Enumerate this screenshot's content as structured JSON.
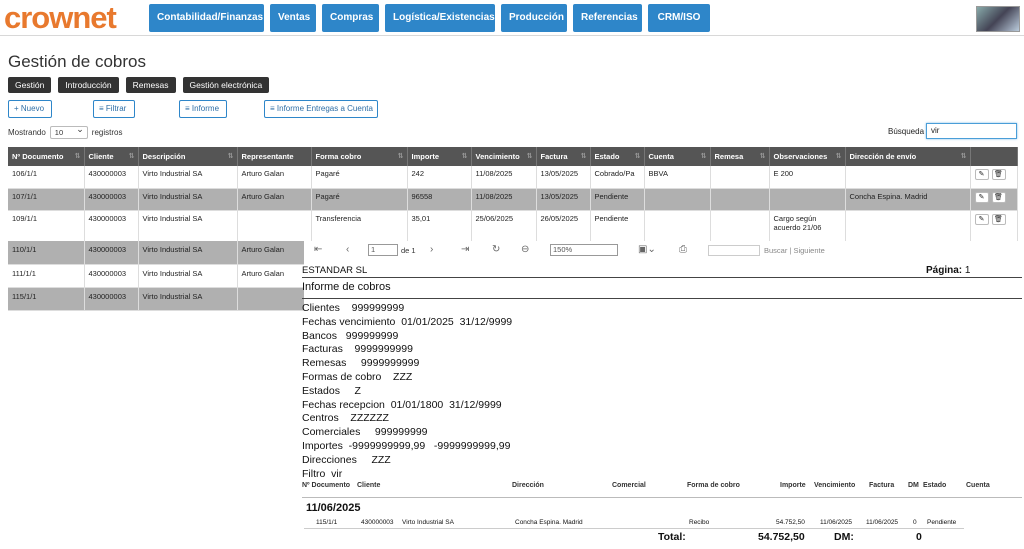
{
  "brand": {
    "logo": "crownet"
  },
  "nav": [
    "Contabilidad/Finanzas",
    "Ventas",
    "Compras",
    "Logística/Existencias",
    "Producción",
    "Referencias",
    "CRM/ISO"
  ],
  "page": {
    "title": "Gestión de cobros"
  },
  "tabs": [
    "Gestión",
    "Introducción",
    "Remesas",
    "Gestión electrónica"
  ],
  "actions": {
    "new": "+ Nuevo",
    "filter": "≡ Filtrar",
    "report": "≡ Informe",
    "report_deliveries": "≡ Informe Entregas a Cuenta"
  },
  "listing": {
    "showing": "Mostrando",
    "page_size": "10",
    "records": "registros",
    "search_label": "Búsqueda",
    "search_value": "vir"
  },
  "table": {
    "headers": [
      "Nº Documento",
      "Cliente",
      "Descripción",
      "Representante",
      "Forma cobro",
      "Importe",
      "Vencimiento",
      "Factura",
      "Estado",
      "Cuenta",
      "Remesa",
      "Observaciones",
      "Dirección de envío"
    ],
    "rows": [
      [
        "106/1/1",
        "430000003",
        "Virto Industrial SA",
        "Arturo Galan",
        "Pagaré",
        "242",
        "11/08/2025",
        "13/05/2025",
        "Cobrado/Pa",
        "BBVA",
        "",
        "E 200",
        ""
      ],
      [
        "107/1/1",
        "430000003",
        "Virto Industrial SA",
        "Arturo Galan",
        "Pagaré",
        "96558",
        "11/08/2025",
        "13/05/2025",
        "Pendiente",
        "",
        "",
        "",
        "Concha Espina. Madrid"
      ],
      [
        "109/1/1",
        "430000003",
        "Virto Industrial SA",
        "",
        "Transferencia",
        "35,01",
        "25/06/2025",
        "26/05/2025",
        "Pendiente",
        "",
        "",
        "Cargo según acuerdo 21/06",
        ""
      ]
    ],
    "partial_rows": [
      [
        "110/1/1",
        "430000003",
        "Virto Industrial SA",
        "Arturo Galan"
      ],
      [
        "111/1/1",
        "430000003",
        "Virto Industrial SA",
        "Arturo Galan"
      ],
      [
        "115/1/1",
        "430000003",
        "Virto Industrial SA",
        ""
      ]
    ]
  },
  "viewer": {
    "page_value": "1",
    "page_of": "de 1",
    "zoom": "150%",
    "find": "Buscar",
    "next": "Siguiente"
  },
  "report": {
    "company": "ESTANDAR SL",
    "page_label": "Página:",
    "page_number": "1",
    "title": "Informe de cobros",
    "filters": [
      "Clientes    999999999",
      "Fechas vencimiento  01/01/2025  31/12/9999",
      "Bancos   999999999",
      "Facturas    9999999999",
      "Remesas     9999999999",
      "Formas de cobro    ZZZ",
      "Estados     Z",
      "Fechas recepcion  01/01/1800  31/12/9999",
      "Centros    ZZZZZZ",
      "Comerciales     999999999",
      "Importes  -9999999999,99   -9999999999,99",
      "Direcciones     ZZZ",
      "Filtro  vir"
    ],
    "columns": [
      "Nº Documento",
      "Cliente",
      "Dirección",
      "Comercial",
      "Forma de cobro",
      "Importe",
      "Vencimiento",
      "Factura",
      "DM",
      "Estado",
      "Cuenta"
    ],
    "group_date": "11/06/2025",
    "detail": [
      "115/1/1",
      "430000003",
      "Virto Industrial SA",
      "Concha Espina. Madrid",
      "Recibo",
      "54.752,50",
      "11/06/2025",
      "11/06/2025",
      "0",
      "Pendiente"
    ],
    "total_label": "Total:",
    "total_value": "54.752,50",
    "dm_label": "DM:",
    "dm_value": "0"
  }
}
